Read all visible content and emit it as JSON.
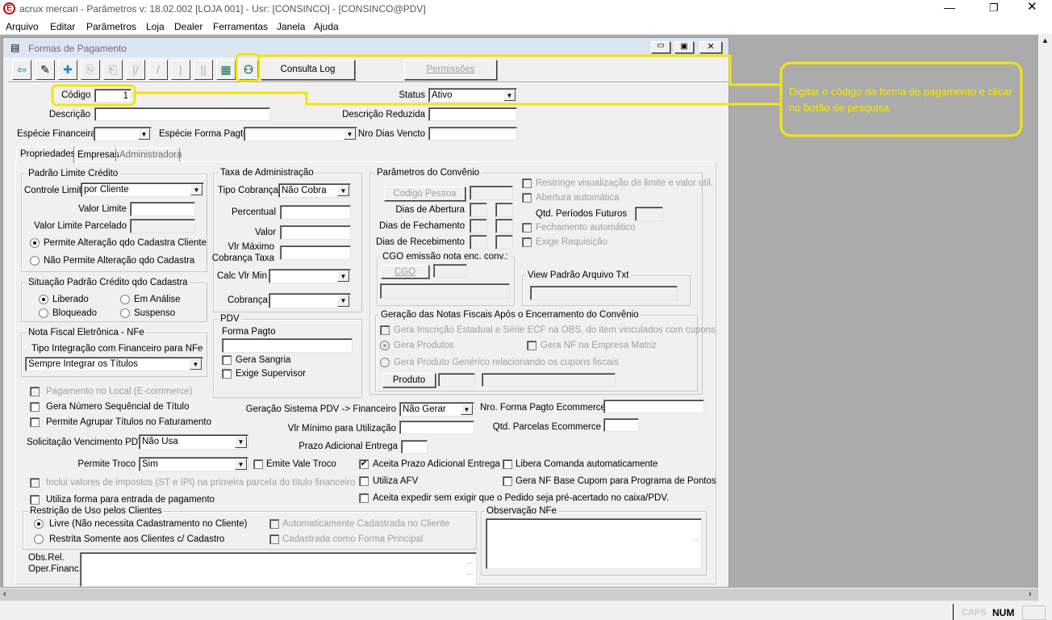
{
  "app": {
    "title": "acrux mercari - Parâmetros  v: 18.02.002   [LOJA 001] - Usr: [CONSINCO] - [CONSINCO@PDV]",
    "logo": "E"
  },
  "menu": [
    "Arquivo",
    "Editar",
    "Parâmetros",
    "Loja",
    "Dealer",
    "Ferramentas",
    "Janela",
    "Ajuda"
  ],
  "window": {
    "title": "Formas de Pagamento"
  },
  "toolbar": {
    "consulta_log": "Consulta Log",
    "permissoes": "Permissões"
  },
  "header": {
    "codigo_label": "Código",
    "codigo_value": "1",
    "status_label": "Status",
    "status_value": "Ativo",
    "descricao_label": "Descrição",
    "descricao_value": "",
    "descricao_reduzida_label": "Descrição Reduzida",
    "especie_financeira_label": "Espécie Financeira",
    "especie_forma_pagto_label": "Espécie Forma Pagto",
    "nro_dias_vencto_label": "Nro Dias Vencto"
  },
  "tabs": [
    "Propriedades",
    "Empresas",
    "Administradora"
  ],
  "limite": {
    "title": "Padrão Limite Crédito",
    "controle_label": "Controle Limite",
    "controle_value": "por Cliente",
    "valor_limite": "Valor Limite",
    "valor_limite_parcelado": "Valor Limite Parcelado",
    "radio1": "Permite Alteração qdo Cadastra Cliente",
    "radio2": "Não Permite Alteração qdo Cadastra"
  },
  "situacao": {
    "title": "Situação Padrão Crédito qdo Cadastra",
    "liberado": "Liberado",
    "em_analise": "Em Análise",
    "bloqueado": "Bloqueado",
    "suspenso": "Suspenso"
  },
  "nfe": {
    "title": "Nota Fiscal Eletrônica - NFe",
    "label": "Tipo Integração com Financeiro para NFe",
    "value": "Sempre Integrar os Títulos"
  },
  "taxa": {
    "title": "Taxa de Administração",
    "tipo_cobranca": "Tipo Cobrança",
    "tipo_cobranca_value": "Não Cobra",
    "percentual": "Percentual",
    "valor": "Valor",
    "vlr_maximo_1": "Vlr Máximo",
    "vlr_maximo_2": "Cobrança Taxa",
    "calc_vlr_min": "Calc Vlr Min",
    "cobranca": "Cobrança"
  },
  "pdv": {
    "title": "PDV",
    "forma_pagto": "Forma Pagto",
    "gera_sangria": "Gera Sangria",
    "exige_supervisor": "Exige Supervisor"
  },
  "convenio": {
    "title": "Parâmetros do Convênio",
    "codigo_pessoa": "Codigo Pessoa",
    "dias_abertura": "Dias de Abertura",
    "dias_fechamento": "Dias de Fechamento",
    "dias_recebimento": "Dias de Recebimento",
    "restringe": "Restringe visualização de limite e valor util.",
    "abertura_auto": "Abertura automática",
    "qtd_periodos": "Qtd. Períodos Futuros",
    "fechamento_auto": "Fechamento automático",
    "exige_requisicao": "Exige Requisição",
    "cgo_title": "CGO emissão nota enc. conv.:",
    "cgo_button": "CGO",
    "view_title": "View Padrão Arquivo Txt",
    "notas_title": "Geração das Notas Fiscais Após o Encerramento do Convênio",
    "gera_inscricao": "Gera Inscrição Estadual e Série ECF na OBS. do item vinculados com cupons",
    "gera_produtos": "Gera Produtos",
    "gera_nf_matriz": "Gera NF na Empresa Matriz",
    "gera_generico": "Gera Produto Genérico relacionando os cupons fiscais",
    "produto_button": "Produto"
  },
  "options": {
    "pagamento_local": "Pagamento no Local (E-commerce)",
    "gera_numero": "Gera Número Sequêncial de Título",
    "permite_agrupar": "Permite Agrupar Títulos no Faturamento",
    "solicitacao_label": "Solicitação Vencimento PDV",
    "solicitacao_value": "Não Usa",
    "permite_troco_label": "Permite Troco",
    "permite_troco_value": "Sim",
    "emite_vale_troco": "Emite Vale Troco",
    "inclui_impostos": "Inclui valores de impostos (ST e IPI) na primeira parcela do título financeiro",
    "utiliza_entrada": "Utiliza forma para entrada de pagamento",
    "geracao_pdv_label": "Geração Sistema PDV -> Financeiro",
    "geracao_pdv_value": "Não Gerar",
    "nro_forma_ecommerce": "Nro. Forma Pagto Ecommerce",
    "vlr_minimo": "Vlr Mínimo para Utilização",
    "qtd_parcelas_ecommerce": "Qtd. Parcelas Ecommerce",
    "prazo_adicional": "Prazo Adicional Entrega",
    "aceita_prazo": "Aceita Prazo Adicional Entrega",
    "libera_comanda": "Libera Comanda automaticamente",
    "utiliza_afv": "Utiliza AFV",
    "gera_nf_cupom": "Gera NF Base Cupom para Programa de Pontos",
    "aceita_expedir": "Aceita expedir sem exigir que o Pedido seja pré-acertado no caixa/PDV."
  },
  "restricao": {
    "title": "Restrição de Uso pelos Clientes",
    "livre": "Livre (Não necessita Cadastramento no Cliente)",
    "restrita": "Restrita Somente aos Clientes c/ Cadastro",
    "auto_cadastrada": "Automaticamente Cadastrada no Cliente",
    "forma_principal": "Cadastrada como Forma Principal"
  },
  "obs_nfe": {
    "title": "Observação NFe"
  },
  "obs_rel": {
    "line1": "Obs.Rel.",
    "line2": "Oper.Financ."
  },
  "annotation": {
    "text": "Digitar o código da forma de pagamento e clicar no botão de pesquisa",
    "color": "#f5e50a"
  },
  "statusbar": {
    "caps": "CAPS",
    "num": "NUM"
  }
}
